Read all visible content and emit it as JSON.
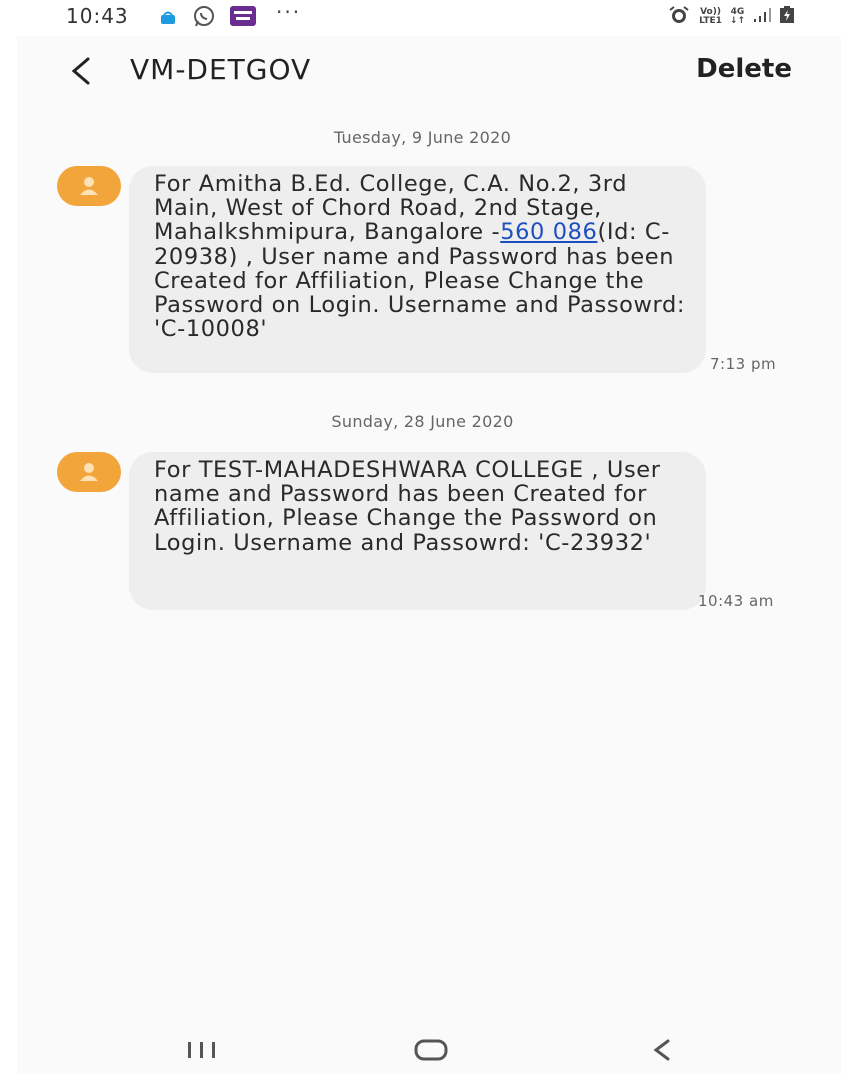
{
  "status_bar": {
    "time": "10:43",
    "more": "···",
    "network_volte": "Vo))",
    "network_lte": "LTE1",
    "network_4g": "4G"
  },
  "header": {
    "title": "VM-DETGOV",
    "delete_label": "Delete"
  },
  "messages": [
    {
      "date": "Tuesday, 9 June 2020",
      "text_before_link": "For Amitha B.Ed. College, C.A. No.2, 3rd Main, West of Chord Road, 2nd Stage, Mahalkshmipura, Bangalore -",
      "link": "560 086",
      "text_after_link": "(Id: C-20938) , User name and Password has been Created for Affiliation, Please Change the Password on Login. Username and Passowrd: 'C-10008'",
      "time": "7:13 pm"
    },
    {
      "date": "Sunday, 28 June 2020",
      "text": "For TEST-MAHADESHWARA COLLEGE , User name and Password has been Created for Affiliation, Please Change the Password on Login. Username and Passowrd: 'C-23932'",
      "time": "10:43 am"
    }
  ],
  "icons": {
    "back": "back-arrow-icon",
    "avatar": "person-icon",
    "nav_recents": "recents-icon",
    "nav_home": "home-icon",
    "nav_back": "nav-back-icon"
  },
  "colors": {
    "avatar": "#f2a53a",
    "bubble": "#eeeeee",
    "link": "#1f4fbf"
  }
}
